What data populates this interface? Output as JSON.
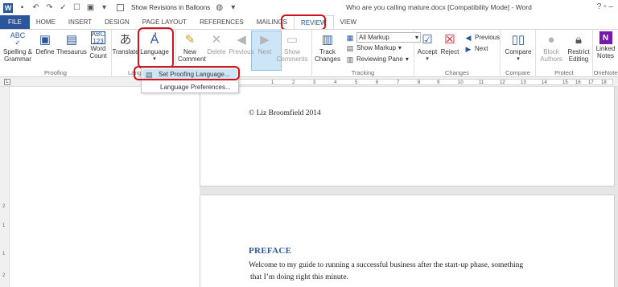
{
  "titlebar": {
    "show_revisions_label": "Show Revisions in Balloons",
    "doc_title": "Who are you calling mature.docx [Compatibility Mode] - Word",
    "window_controls": "?  ▫  –"
  },
  "tabs": [
    "FILE",
    "HOME",
    "INSERT",
    "DESIGN",
    "PAGE LAYOUT",
    "REFERENCES",
    "MAILINGS",
    "REVIEW",
    "VIEW"
  ],
  "ribbon": {
    "proofing": {
      "label": "Proofing",
      "spelling": "Spelling & Grammar",
      "define": "Define",
      "thesaurus": "Thesaurus",
      "word_count": "Word Count"
    },
    "language": {
      "label": "Lang",
      "translate": "Translate",
      "language": "Language"
    },
    "comments": {
      "label": "ments",
      "new_comment": "New Comment",
      "delete": "Delete",
      "previous": "Previous",
      "next": "Next",
      "show_comments": "Show Comments"
    },
    "tracking": {
      "label": "Tracking",
      "track_changes": "Track Changes",
      "markup_select": "All Markup",
      "show_markup": "Show Markup",
      "reviewing_pane": "Reviewing Pane"
    },
    "changes": {
      "label": "Changes",
      "accept": "Accept",
      "reject": "Reject",
      "previous": "Previous",
      "next": "Next"
    },
    "compare": {
      "label": "Compare",
      "compare": "Compare"
    },
    "protect": {
      "label": "Protect",
      "block_authors": "Block Authors",
      "restrict_editing": "Restrict Editing"
    },
    "onenote": {
      "label": "OneNote",
      "linked_notes": "Linked Notes"
    }
  },
  "language_menu": {
    "set_proofing": "Set Proofing Language...",
    "preferences": "Language Preferences..."
  },
  "ruler": {
    "numbers": [
      "2",
      "1",
      "1",
      "2",
      "3",
      "4",
      "5",
      "6",
      "7",
      "8",
      "9",
      "10",
      "11",
      "12",
      "13",
      "14",
      "15",
      "16",
      "17",
      "18"
    ]
  },
  "vruler": {
    "numbers": [
      "2",
      "1",
      "1",
      "2"
    ]
  },
  "document": {
    "copyright": "© Liz Broomfield 2014",
    "heading": "PREFACE",
    "line1": "Welcome to my guide to running a successful business after the start-up phase, something",
    "line2": "that I’m doing right this minute."
  },
  "colors": {
    "file_tab": "#2b579a",
    "accent": "#2b579a",
    "highlight_ring": "#d0121b",
    "hover_blue": "#cde6f7",
    "heading_blue": "#2e5aa8"
  }
}
